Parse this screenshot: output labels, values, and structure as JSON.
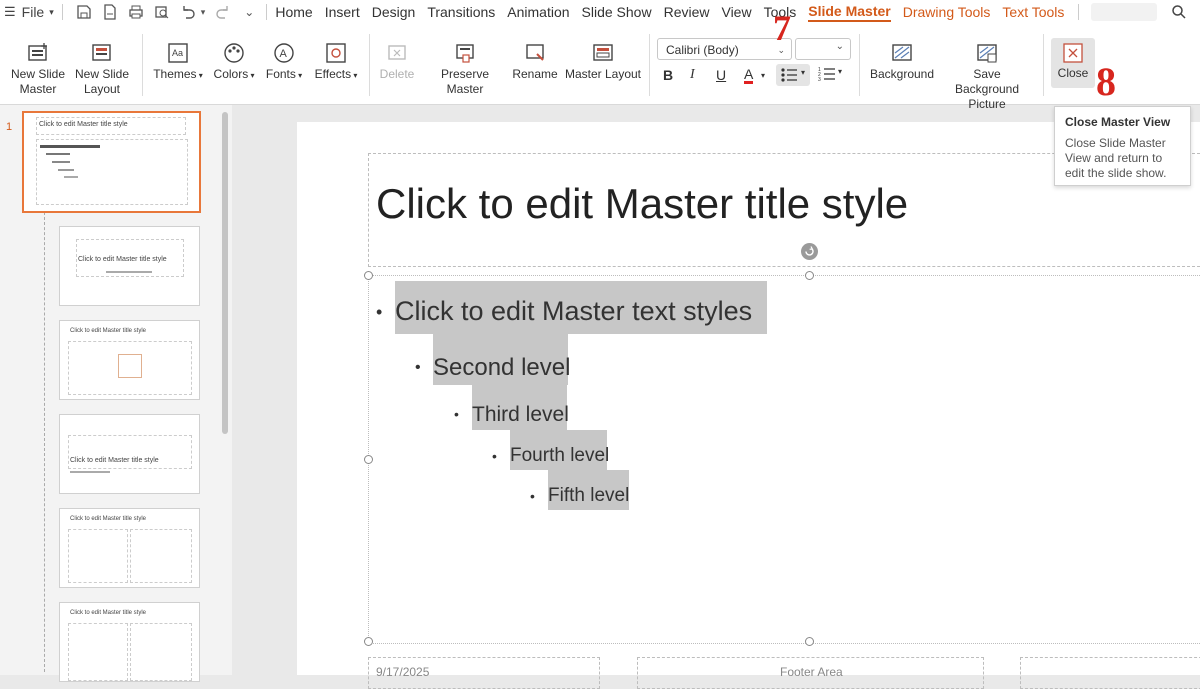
{
  "menubar": {
    "file_label": "File",
    "tabs": [
      {
        "label": "Home"
      },
      {
        "label": "Insert"
      },
      {
        "label": "Design"
      },
      {
        "label": "Transitions"
      },
      {
        "label": "Animation"
      },
      {
        "label": "Slide Show"
      },
      {
        "label": "Review"
      },
      {
        "label": "View"
      },
      {
        "label": "Tools"
      }
    ],
    "active_tab": "Slide Master",
    "context_tabs": [
      {
        "label": "Drawing Tools"
      },
      {
        "label": "Text Tools"
      }
    ]
  },
  "ribbon": {
    "new_slide_master": "New Slide\nMaster",
    "new_slide_layout": "New Slide\nLayout",
    "themes": "Themes",
    "colors": "Colors",
    "fonts": "Fonts",
    "effects": "Effects",
    "delete": "Delete",
    "preserve_master": "Preserve Master",
    "rename": "Rename",
    "master_layout": "Master Layout",
    "font_name": "Calibri (Body)",
    "background": "Background",
    "save_background_picture": "Save Background\nPicture",
    "close": "Close"
  },
  "annotations": {
    "seven": "7",
    "eight": "8"
  },
  "tooltip": {
    "title": "Close Master View",
    "body": "Close Slide Master View and return to edit the slide show."
  },
  "thumbs": {
    "first_number": "1"
  },
  "slide": {
    "title": "Click to edit Master title style",
    "levels": [
      "Click to edit Master text styles",
      "Second level",
      "Third level",
      "Fourth level",
      "Fifth level"
    ],
    "date": "9/17/2025",
    "footer": "Footer Area"
  },
  "colors": {
    "accent": "#d35a1a",
    "selection": "#e8773a",
    "callout": "#d7261e"
  }
}
